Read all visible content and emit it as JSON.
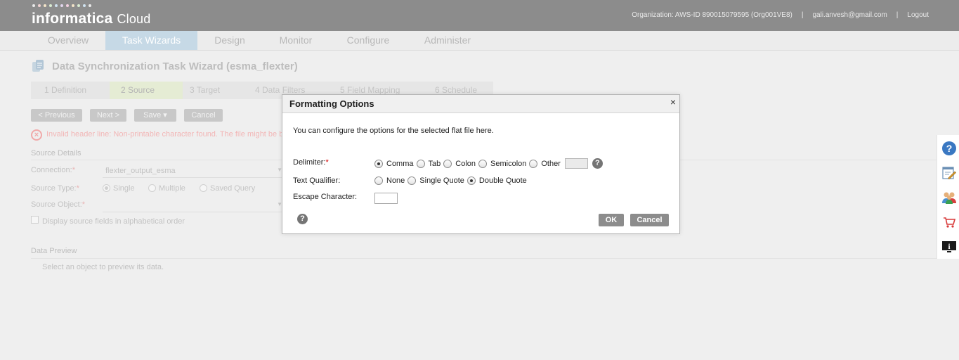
{
  "header": {
    "logo_main": "informatica",
    "logo_sub": "Cloud",
    "organization": "Organization: AWS-ID 890015079595 (Org001VE8)",
    "user": "gali.anvesh@gmail.com",
    "logout": "Logout",
    "separator": "|"
  },
  "nav": {
    "tabs": [
      {
        "label": "Overview"
      },
      {
        "label": "Task Wizards"
      },
      {
        "label": "Design"
      },
      {
        "label": "Monitor"
      },
      {
        "label": "Configure"
      },
      {
        "label": "Administer"
      }
    ],
    "active_tab": "Task Wizards"
  },
  "wizard": {
    "title": "Data Synchronization Task Wizard (esma_flexter)",
    "steps": [
      {
        "label": "1  Definition"
      },
      {
        "label": "2  Source"
      },
      {
        "label": "3  Target"
      },
      {
        "label": "4  Data Filters"
      },
      {
        "label": "5  Field Mapping"
      },
      {
        "label": "6  Schedule"
      }
    ],
    "active_step": "2  Source",
    "buttons": {
      "previous": "< Previous",
      "next": "Next >",
      "save": "Save  ▾",
      "cancel": "Cancel"
    },
    "error_message": "Invalid header line: Non-printable character found. The file might be b"
  },
  "source_details": {
    "heading": "Source Details",
    "connection_label": "Connection:",
    "connection_value": "flexter_output_esma",
    "source_type_label": "Source Type:",
    "source_type_options": [
      "Single",
      "Multiple",
      "Saved Query"
    ],
    "source_type_selected": "Single",
    "source_object_label": "Source Object:",
    "source_object_value": "",
    "alpha_order_label": "Display source fields in alphabetical order",
    "required_mark": "*"
  },
  "data_preview": {
    "heading": "Data Preview",
    "empty_text": "Select an object to preview its data."
  },
  "side_toolbar": {
    "icons": [
      "help-icon",
      "notes-icon",
      "community-icon",
      "cart-icon",
      "monitor-info-icon"
    ]
  },
  "dialog": {
    "title": "Formatting Options",
    "close": "×",
    "intro": "You can configure the options for the selected flat file here.",
    "delimiter": {
      "label": "Delimiter:",
      "required_mark": "*",
      "options": [
        "Comma",
        "Tab",
        "Colon",
        "Semicolon",
        "Other"
      ],
      "selected": "Comma",
      "other_value": ""
    },
    "text_qualifier": {
      "label": "Text Qualifier:",
      "options": [
        "None",
        "Single Quote",
        "Double Quote"
      ],
      "selected": "Double Quote"
    },
    "escape_character": {
      "label": "Escape Character:",
      "value": ""
    },
    "ok": "OK",
    "cancel": "Cancel",
    "help_glyph": "?"
  },
  "colors": {
    "header_bg": "#8c8c8c",
    "active_tab_bg": "#c6d9e6",
    "overlay_bg": "#efefef",
    "dialog_button": "#8c8c8c",
    "help_blue": "#3a78c2"
  }
}
